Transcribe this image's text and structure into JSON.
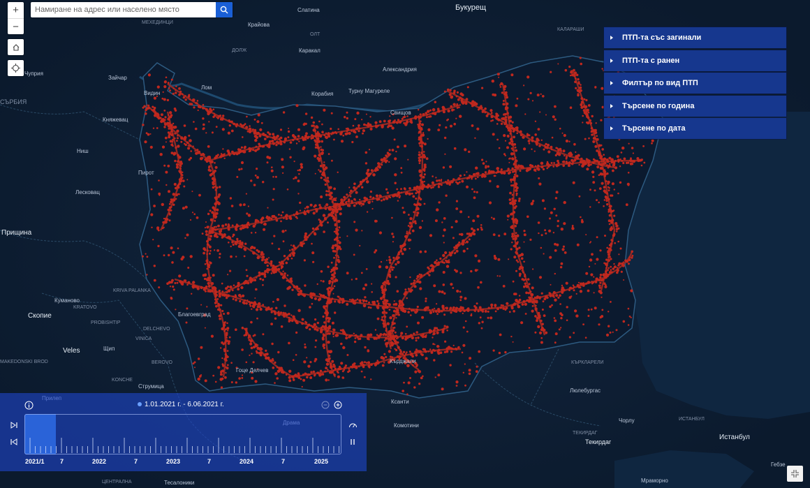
{
  "search": {
    "placeholder": "Намиране на адрес или населено място"
  },
  "map_controls": {
    "zoom_in": "+",
    "zoom_out": "−"
  },
  "panel": {
    "items": [
      {
        "label": "ПТП-та със загинали"
      },
      {
        "label": "ПТП-та с ранен"
      },
      {
        "label": "Филтър по вид ПТП"
      },
      {
        "label": "Търсене по година"
      },
      {
        "label": "Търсене по дата"
      }
    ]
  },
  "timeline": {
    "date_range": "1.01.2021 г. - 6.06.2021 г.",
    "labels": [
      "2021/1",
      "7",
      "2022",
      "7",
      "2023",
      "7",
      "2024",
      "7",
      "2025"
    ],
    "selection_fraction": 0.1
  },
  "places": [
    {
      "name": "Букурещ"
    },
    {
      "name": "Слатина"
    },
    {
      "name": "МЕХЕДИНЦИ"
    },
    {
      "name": "Крайова"
    },
    {
      "name": "ОЛТ"
    },
    {
      "name": "КАЛАРАШИ"
    },
    {
      "name": "ДОЛЖ"
    },
    {
      "name": "Каракал"
    },
    {
      "name": "Александрия"
    },
    {
      "name": "Чуприя"
    },
    {
      "name": "Зайчар"
    },
    {
      "name": "Видин"
    },
    {
      "name": "Лом"
    },
    {
      "name": "Корабия"
    },
    {
      "name": "Турну Магуреле"
    },
    {
      "name": "Свищов"
    },
    {
      "name": "СЪРБИЯ"
    },
    {
      "name": "Княжевац"
    },
    {
      "name": "Ниш"
    },
    {
      "name": "Пирот"
    },
    {
      "name": "Лесковац"
    },
    {
      "name": "Прищина"
    },
    {
      "name": "Куманово"
    },
    {
      "name": "KRIVA PALANKA"
    },
    {
      "name": "KRATOVO"
    },
    {
      "name": "PROBISHTIP"
    },
    {
      "name": "Скопие"
    },
    {
      "name": "DELCHEVO"
    },
    {
      "name": "VINICA"
    },
    {
      "name": "Щип"
    },
    {
      "name": "Veles"
    },
    {
      "name": "BEROVO"
    },
    {
      "name": "MAKEDONSKI BROD"
    },
    {
      "name": "KONCHE"
    },
    {
      "name": "Струмица"
    },
    {
      "name": "Прилеп"
    },
    {
      "name": "Благоевград"
    },
    {
      "name": "Гоце Делчев"
    },
    {
      "name": "Кърджали"
    },
    {
      "name": "Комотини"
    },
    {
      "name": "КЪРКЛАРЕЛИ"
    },
    {
      "name": "Люлебургас"
    },
    {
      "name": "Чорлу"
    },
    {
      "name": "ИСТАНБУЛ"
    },
    {
      "name": "ТЕКИРДАГ"
    },
    {
      "name": "Текирдаг"
    },
    {
      "name": "Истанбул"
    },
    {
      "name": "Гебзе"
    },
    {
      "name": "Мраморно"
    },
    {
      "name": "ЦЕНТРАЛНА"
    },
    {
      "name": "Тесалоники"
    },
    {
      "name": "Драма"
    },
    {
      "name": "Ксанти"
    }
  ],
  "icons": {
    "search": "search-icon",
    "home": "home-icon",
    "locate": "locate-icon",
    "info": "info-icon",
    "zoom_out_time": "minus-circle-icon",
    "zoom_in_time": "plus-circle-icon",
    "next": "skip-forward-icon",
    "prev": "skip-back-icon",
    "settings": "speed-icon",
    "pause": "pause-icon",
    "expand": "collapse-icon"
  },
  "colors": {
    "accident": "#c0281e",
    "panel": "#16378e",
    "background": "#0d1d33",
    "timeline": "#1e46c8"
  }
}
